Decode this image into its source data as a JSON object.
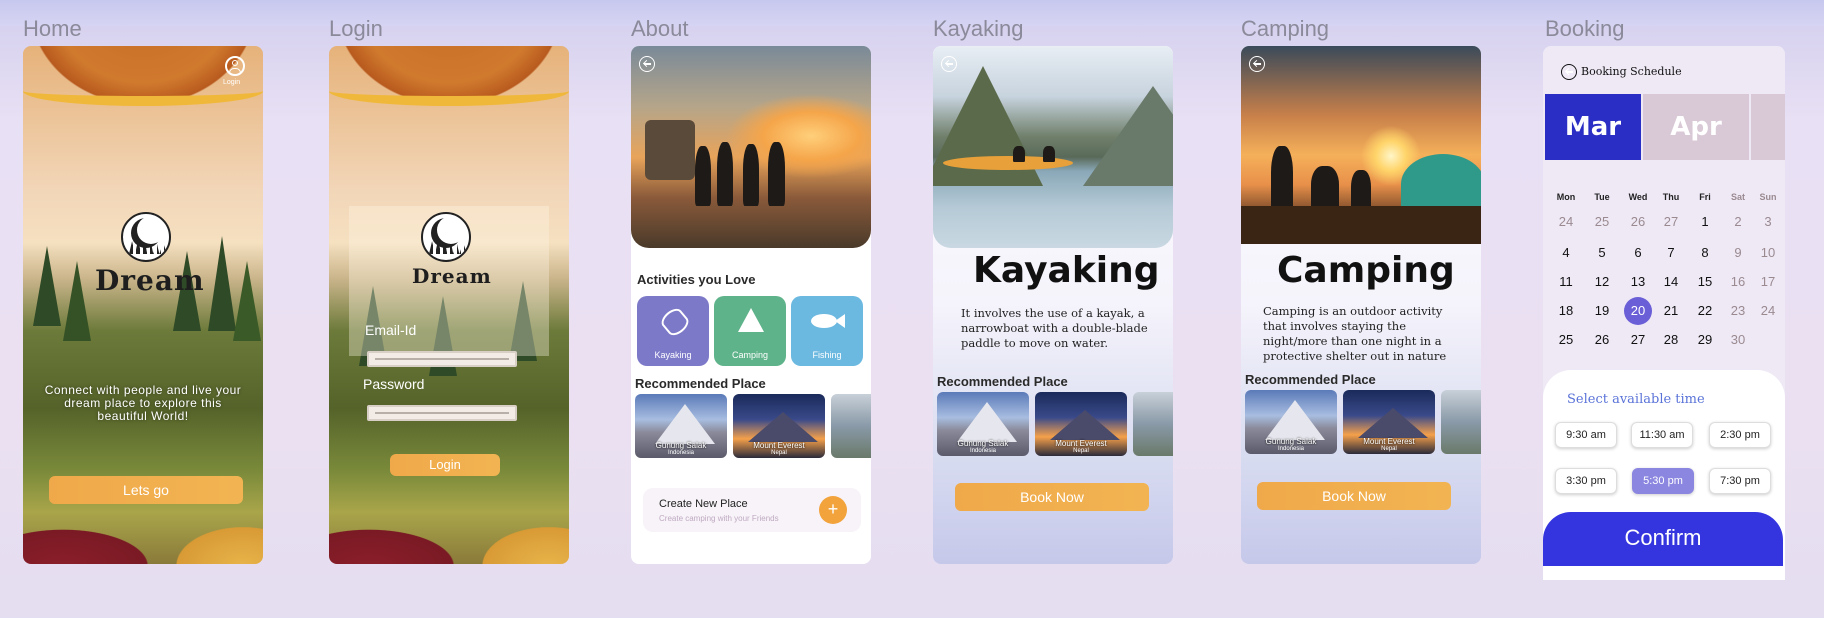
{
  "frames": {
    "home": "Home",
    "login": "Login",
    "about": "About",
    "kayaking": "Kayaking",
    "camping": "Camping",
    "booking": "Booking"
  },
  "home": {
    "login_label": "Login",
    "brand": "Dream",
    "tagline": "Connect with people and live your dream place to explore this beautiful World!",
    "cta": "Lets go"
  },
  "login": {
    "brand": "Dream",
    "email_label": "Email-Id",
    "password_label": "Password",
    "submit": "Login"
  },
  "about": {
    "activities_heading": "Activities you Love",
    "activities": [
      {
        "label": "Kayaking",
        "icon": "kayak-icon",
        "color": "#7d79c9"
      },
      {
        "label": "Camping",
        "icon": "tent-icon",
        "color": "#5fb38a"
      },
      {
        "label": "Fishing",
        "icon": "fish-icon",
        "color": "#6bb8e0"
      }
    ],
    "recommended_heading": "Recommended Place",
    "places": [
      {
        "name": "Gunung Salak",
        "sub": "Indonesia"
      },
      {
        "name": "Mount Everest",
        "sub": "Nepal"
      }
    ],
    "create_title": "Create  New Place",
    "create_subtitle": "Create camping with your Friends",
    "create_button": "+"
  },
  "kayaking": {
    "title": "Kayaking",
    "description": "It involves the use of a kayak, a narrowboat with a double-blade paddle to move on water.",
    "recommended_heading": "Recommended Place",
    "places": [
      {
        "name": "Gunung Salak",
        "sub": "Indonesia"
      },
      {
        "name": "Mount Everest",
        "sub": "Nepal"
      }
    ],
    "book_button": "Book Now"
  },
  "camping": {
    "title": "Camping",
    "description": "Camping is an outdoor activity that involves staying the night/more than one night in a protective shelter out in nature",
    "recommended_heading": "Recommended Place",
    "places": [
      {
        "name": "Gunung Salak",
        "sub": "Indonesia"
      },
      {
        "name": "Mount Everest",
        "sub": "Nepal"
      }
    ],
    "book_button": "Book Now"
  },
  "booking": {
    "header": "Booking Schedule",
    "months": [
      "Mar",
      "Apr"
    ],
    "weekdays": [
      "Mon",
      "Tue",
      "Wed",
      "Thu",
      "Fri",
      "Sat",
      "Sun"
    ],
    "weeks": [
      [
        "24",
        "25",
        "26",
        "27",
        "1",
        "2",
        "3"
      ],
      [
        "4",
        "5",
        "6",
        "7",
        "8",
        "9",
        "10"
      ],
      [
        "11",
        "12",
        "13",
        "14",
        "15",
        "16",
        "17"
      ],
      [
        "18",
        "19",
        "20",
        "21",
        "22",
        "23",
        "24"
      ],
      [
        "25",
        "26",
        "27",
        "28",
        "29",
        "30",
        ""
      ]
    ],
    "selected_day": "20",
    "time_heading": "Select available time",
    "times": [
      "9:30 am",
      "11:30 am",
      "2:30 pm",
      "3:30 pm",
      "5:30 pm",
      "7:30 pm"
    ],
    "selected_time": "5:30 pm",
    "confirm": "Confirm"
  }
}
